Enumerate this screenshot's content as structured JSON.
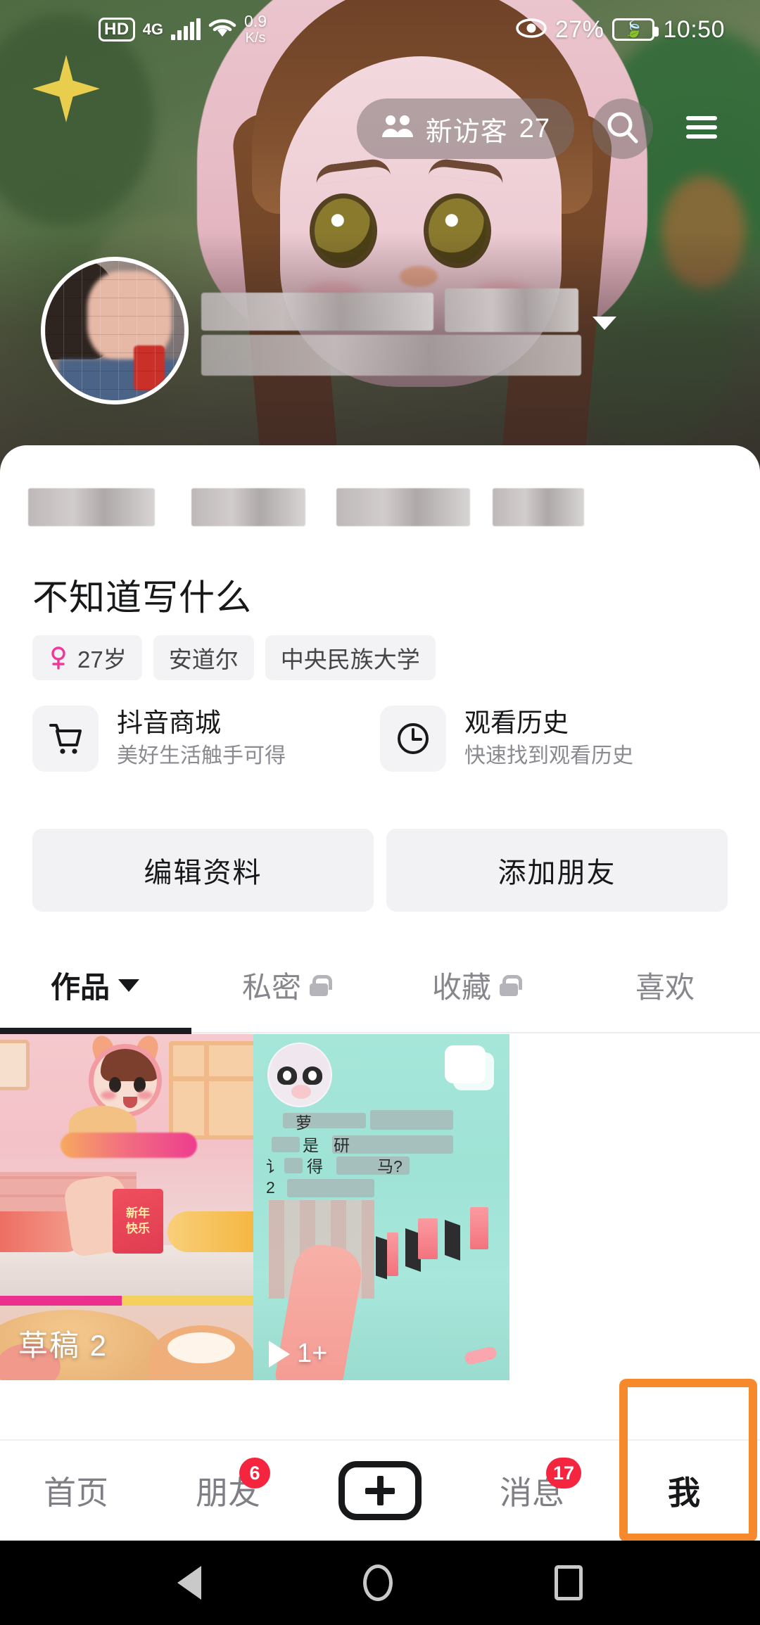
{
  "status_bar": {
    "hd_label": "HD",
    "network_label": "4G",
    "speed_value": "0.9",
    "speed_unit": "K/s",
    "eye_icon": "eye-icon",
    "battery_percent": "27%",
    "battery_saver_icon": "leaf-icon",
    "time": "10:50"
  },
  "top_nav": {
    "visitors_icon": "people-icon",
    "visitors_label": "新访客",
    "visitors_count": "27",
    "search_icon": "search-icon",
    "menu_icon": "hamburger-menu-icon"
  },
  "profile": {
    "avatar": "user-avatar",
    "name_redacted": true,
    "name_caret_icon": "chevron-down-icon",
    "stats_redacted": true,
    "bio": "不知道写什么",
    "tags": [
      {
        "icon": "female-icon",
        "label": "27岁"
      },
      {
        "icon": "",
        "label": "安道尔"
      },
      {
        "icon": "",
        "label": "中央民族大学"
      }
    ]
  },
  "shortcuts": [
    {
      "icon": "shopping-cart-icon",
      "title": "抖音商城",
      "subtitle": "美好生活触手可得"
    },
    {
      "icon": "clock-icon",
      "title": "观看历史",
      "subtitle": "快速找到观看历史"
    }
  ],
  "actions": [
    {
      "label": "编辑资料"
    },
    {
      "label": "添加朋友"
    }
  ],
  "tabs": [
    {
      "label": "作品",
      "active": true,
      "caret_icon": "caret-down-icon",
      "lock_icon": ""
    },
    {
      "label": "私密",
      "active": false,
      "caret_icon": "",
      "lock_icon": "lock-icon"
    },
    {
      "label": "收藏",
      "active": false,
      "caret_icon": "",
      "lock_icon": "lock-icon"
    },
    {
      "label": "喜欢",
      "active": false,
      "caret_icon": "",
      "lock_icon": ""
    }
  ],
  "grid": [
    {
      "type": "draft",
      "label": "草稿 2",
      "red_packet_text_line1": "新年",
      "red_packet_text_line2": "快乐"
    },
    {
      "type": "video",
      "play_icon": "play-icon",
      "play_count": "1+",
      "overlay_chars": [
        "萝",
        "是",
        "研",
        "得",
        "马?",
        "2",
        "讠"
      ]
    }
  ],
  "bottom_nav": [
    {
      "label": "首页",
      "badge": "",
      "active": false,
      "icon": ""
    },
    {
      "label": "朋友",
      "badge": "6",
      "active": false,
      "icon": ""
    },
    {
      "label": "",
      "badge": "",
      "active": false,
      "icon": "plus-icon"
    },
    {
      "label": "消息",
      "badge": "17",
      "active": false,
      "icon": ""
    },
    {
      "label": "我",
      "badge": "",
      "active": true,
      "icon": ""
    }
  ],
  "highlight": {
    "target": "bottom-nav-item-me",
    "color": "#f5892c"
  },
  "system_nav": {
    "back_icon": "back-triangle-icon",
    "home_icon": "home-circle-icon",
    "recents_icon": "recents-square-icon"
  }
}
